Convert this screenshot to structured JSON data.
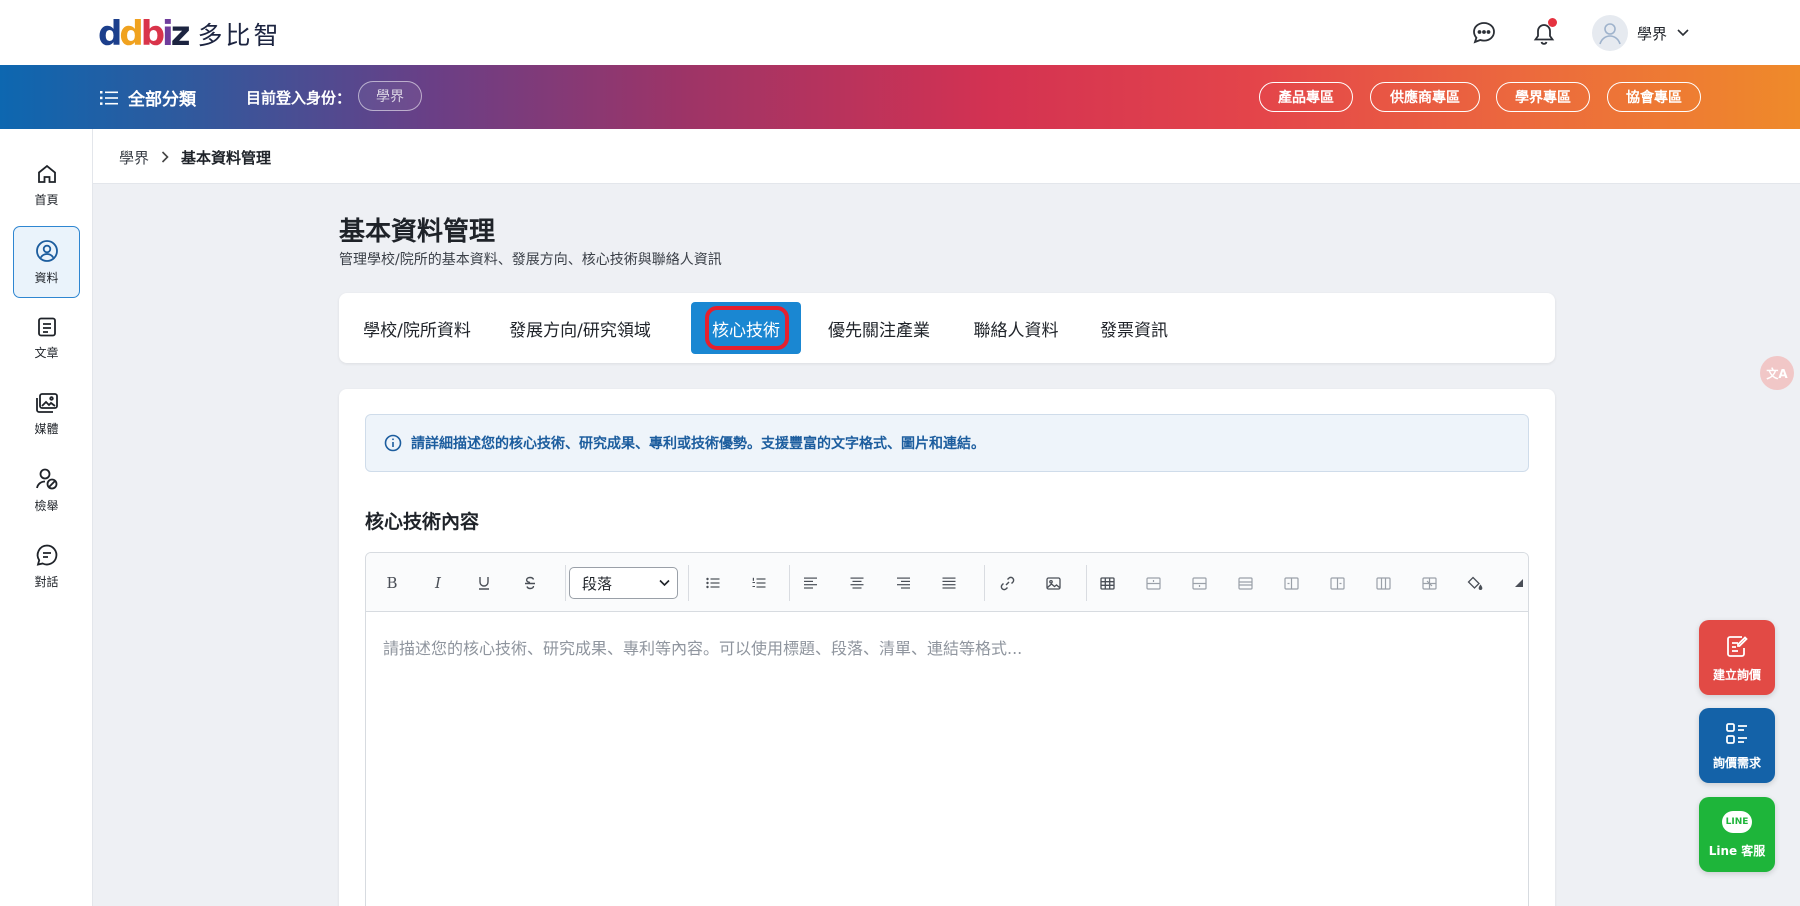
{
  "brand": {
    "mark": "dbiz",
    "name": "多比智"
  },
  "header": {
    "user_name": "學界"
  },
  "navbar": {
    "all_categories": "全部分類",
    "login_identity_label": "目前登入身份：",
    "login_identity_value": "學界",
    "zones": [
      "產品專區",
      "供應商專區",
      "學界專區",
      "協會專區"
    ]
  },
  "sidebar": {
    "items": [
      {
        "label": "首頁",
        "icon": "home-icon"
      },
      {
        "label": "資料",
        "icon": "profile-icon"
      },
      {
        "label": "文章",
        "icon": "article-icon"
      },
      {
        "label": "媒體",
        "icon": "media-icon"
      },
      {
        "label": "檢舉",
        "icon": "report-icon"
      },
      {
        "label": "對話",
        "icon": "chat-icon"
      }
    ]
  },
  "breadcrumb": {
    "parent": "學界",
    "current": "基本資料管理"
  },
  "page": {
    "title": "基本資料管理",
    "subtitle": "管理學校/院所的基本資料、發展方向、核心技術與聯絡人資訊"
  },
  "tabs": [
    {
      "label": "學校/院所資料"
    },
    {
      "label": "發展方向/研究領域"
    },
    {
      "label": "核心技術",
      "active": true
    },
    {
      "label": "優先關注產業"
    },
    {
      "label": "聯絡人資料"
    },
    {
      "label": "發票資訊"
    }
  ],
  "content": {
    "info_text": "請詳細描述您的核心技術、研究成果、專利或技術優勢。支援豐富的文字格式、圖片和連結。",
    "section_title": "核心技術內容",
    "paragraph_select": "段落",
    "placeholder": "請描述您的核心技術、研究成果、專利等內容。可以使用標題、段落、清單、連結等格式..."
  },
  "floating": {
    "create_inquiry": "建立詢價",
    "inquiry_needs": "詢價需求",
    "line_service": "Line 客服",
    "line_badge": "LINE",
    "translate_glyph": "文A"
  },
  "colors": {
    "primary": "#1a87d2",
    "highlight_ring": "#e5202e",
    "fab_red": "#e24a45",
    "fab_blue": "#1462a8",
    "fab_green": "#1eb53a"
  }
}
